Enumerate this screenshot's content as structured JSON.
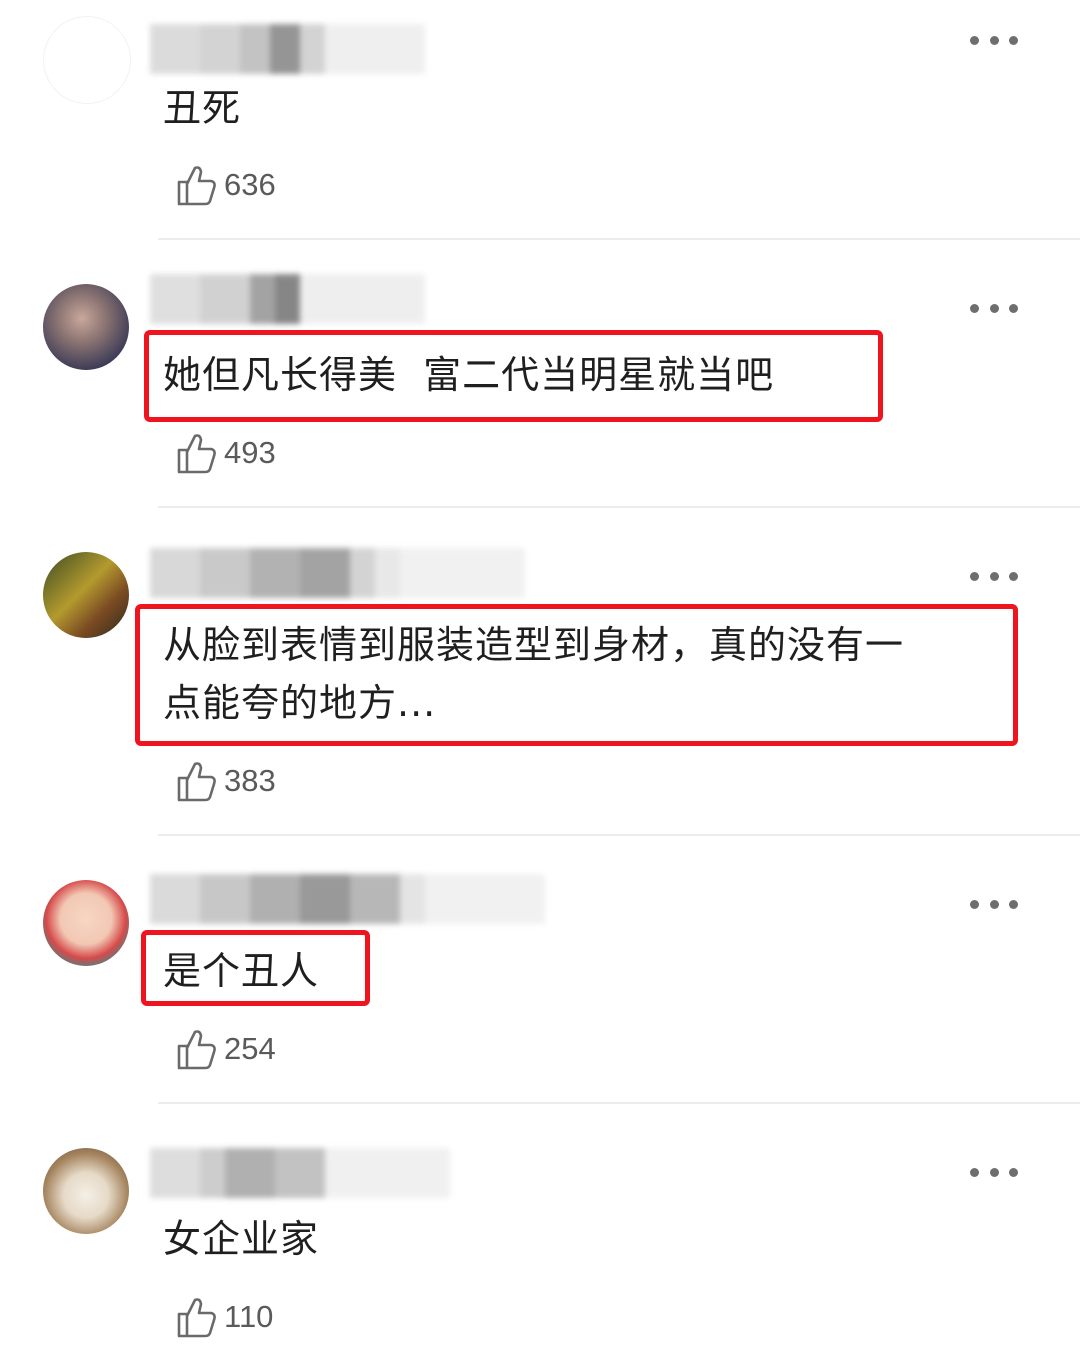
{
  "comments": [
    {
      "text": "丑死",
      "likes": "636",
      "highlighted": false
    },
    {
      "text": "她但凡长得美  富二代当明星就当吧",
      "likes": "493",
      "highlighted": true
    },
    {
      "text": "从脸到表情到服装造型到身材，真的没有一\n点能夸的地方...",
      "likes": "383",
      "highlighted": true
    },
    {
      "text": "是个丑人",
      "likes": "254",
      "highlighted": true
    },
    {
      "text": "女企业家",
      "likes": "110",
      "highlighted": false
    }
  ],
  "icons": {
    "like": "thumbs-up-icon",
    "more": "more-dots-icon"
  },
  "colors": {
    "highlight": "#f0141e",
    "text": "#1f1f1f",
    "count": "#5a5a5a",
    "divider": "#ececec"
  }
}
